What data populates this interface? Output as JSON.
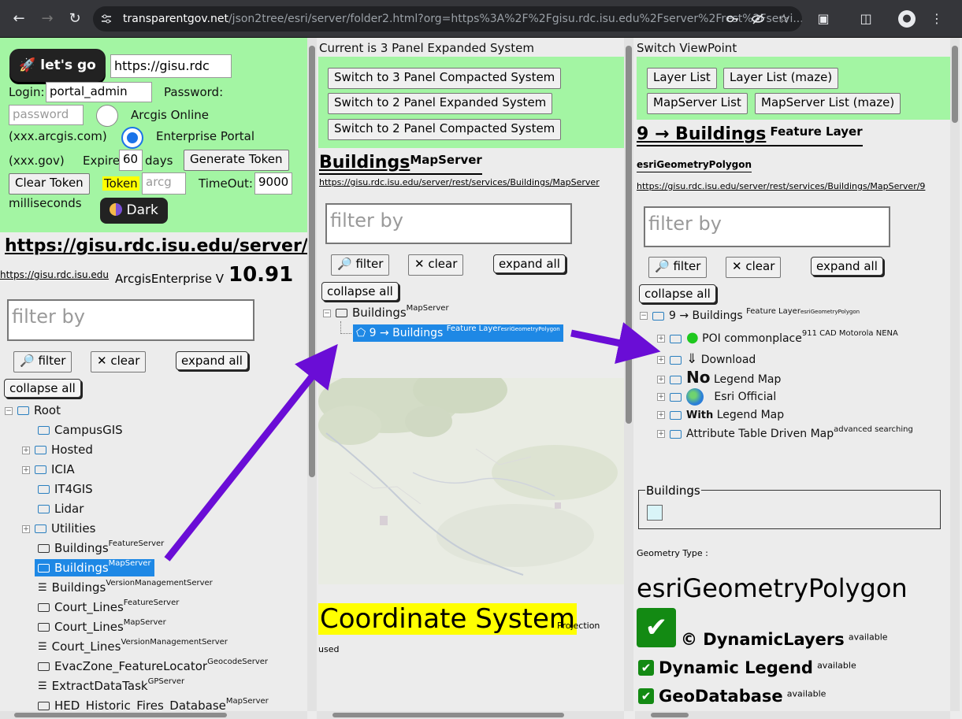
{
  "browser": {
    "url_host": "transparentgov.net",
    "url_rest": "/json2tree/esri/server/folder2.html?org=https%3A%2F%2Fgisu.rdc.isu.edu%2Fserver%2Frest%2Fservi..."
  },
  "panel1": {
    "lets_go": "let's go",
    "url_input": "https://gisu.rdc",
    "login_label": "Login:",
    "login_value": "portal_admin",
    "password_label": "Password:",
    "password_placeholder": "password",
    "arcgis_online": "Arcgis Online",
    "arcgis_online_hint": "(xxx.arcgis.com)",
    "enterprise_portal": "Enterprise Portal",
    "gov_hint": "(xxx.gov)",
    "expire_label": "Expire",
    "expire_value": "60",
    "days": "days",
    "generate_token": "Generate Token",
    "clear_token": "Clear Token",
    "token_label": "Token",
    "token_placeholder": "arcg",
    "timeout_label": "TimeOut:",
    "timeout_value": "9000",
    "milliseconds": "milliseconds",
    "dark": "Dark",
    "server_url_title": "https://gisu.rdc.isu.edu/server/rest",
    "server_link": "https://gisu.rdc.isu.edu",
    "arcgis_enterprise": "ArcgisEnterprise",
    "version_prefix": "V",
    "version": "10.91",
    "filter_placeholder": "filter by",
    "filter_btn": "filter",
    "clear_btn": "clear",
    "expand_all": "expand all",
    "collapse_all": "collapse all",
    "tree": [
      {
        "label": "Root",
        "suffix": ""
      },
      {
        "label": "CampusGIS",
        "suffix": ""
      },
      {
        "label": "Hosted",
        "suffix": ""
      },
      {
        "label": "ICIA",
        "suffix": ""
      },
      {
        "label": "IT4GIS",
        "suffix": ""
      },
      {
        "label": "Lidar",
        "suffix": ""
      },
      {
        "label": "Utilities",
        "suffix": ""
      },
      {
        "label": "Buildings",
        "suffix": "FeatureServer"
      },
      {
        "label": "Buildings",
        "suffix": "MapServer"
      },
      {
        "label": "Buildings",
        "suffix": "VersionManagementServer"
      },
      {
        "label": "Court_Lines",
        "suffix": "FeatureServer"
      },
      {
        "label": "Court_Lines",
        "suffix": "MapServer"
      },
      {
        "label": "Court_Lines",
        "suffix": "VersionManagementServer"
      },
      {
        "label": "EvacZone_FeatureLocator",
        "suffix": "GeocodeServer"
      },
      {
        "label": "ExtractDataTask",
        "suffix": "GPServer"
      },
      {
        "label": "HED_Historic_Fires_Database",
        "suffix": "MapServer"
      }
    ]
  },
  "panel2": {
    "header": "Current is 3 Panel Expanded System",
    "switch1": "Switch to 3 Panel Compacted System",
    "switch2": "Switch to 2 Panel Expanded System",
    "switch3": "Switch to 2 Panel Compacted System",
    "title": "Buildings",
    "title_type": "MapServer",
    "service_url": "https://gisu.rdc.isu.edu/server/rest/services/Buildings/MapServer",
    "filter_placeholder": "filter by",
    "filter_btn": "filter",
    "clear_btn": "clear",
    "expand_all": "expand all",
    "collapse_all": "collapse all",
    "tree_root": "Buildings",
    "tree_root_type": "MapServer",
    "tree_child": "9 → Buildings",
    "tree_child_type": "Feature Layer",
    "tree_child_geom": "esriGeometryPolygon",
    "coordinate_system": "Coordinate System",
    "projection_note": "Projection",
    "projection_note2": "used"
  },
  "panel3": {
    "header": "Switch ViewPoint",
    "btn_layer_list": "Layer List",
    "btn_layer_list_maze": "Layer List (maze)",
    "btn_mapserver_list": "MapServer List",
    "btn_mapserver_list_maze": "MapServer List (maze)",
    "title": "9 → Buildings",
    "title_type": "Feature Layer",
    "geom_label": "esriGeometryPolygon",
    "layer_url": "https://gisu.rdc.isu.edu/server/rest/services/Buildings/MapServer/9",
    "filter_placeholder": "filter by",
    "filter_btn": "filter",
    "clear_btn": "clear",
    "expand_all": "expand all",
    "collapse_all": "collapse all",
    "tree_root": "9 → Buildings",
    "tree_root_type": "Feature Layer",
    "tree_root_geom": "esriGeometryPolygon",
    "children": [
      {
        "icon": "map-pin-icon",
        "label": "POI commonplace",
        "sup": "911 CAD Motorola NENA"
      },
      {
        "icon": "download-arrow-icon",
        "label": "Download",
        "sup": ""
      },
      {
        "icon": "no-text-icon",
        "label": "Legend Map",
        "prefix": "No",
        "sup": ""
      },
      {
        "icon": "globe-icon",
        "label": "Esri Official",
        "sup": ""
      },
      {
        "icon": "with-text-icon",
        "label": "Legend Map",
        "prefix": "With",
        "sup": ""
      },
      {
        "icon": "",
        "label": "Attribute Table Driven Map",
        "sup": "advanced searching"
      }
    ],
    "legend_title": "Buildings",
    "geometry_type_label": "Geometry Type :",
    "geometry_type": "esriGeometryPolygon",
    "dynamic_layers": "© DynamicLayers",
    "dynamic_legend": "Dynamic Legend",
    "geodatabase": "GeoDatabase",
    "available": "available"
  },
  "colors": {
    "green_panel": "#a3f5a3",
    "selected": "#1e88e5",
    "arrow": "#6a0dd6",
    "highlight": "#ffff00",
    "check_green": "#138a13"
  }
}
